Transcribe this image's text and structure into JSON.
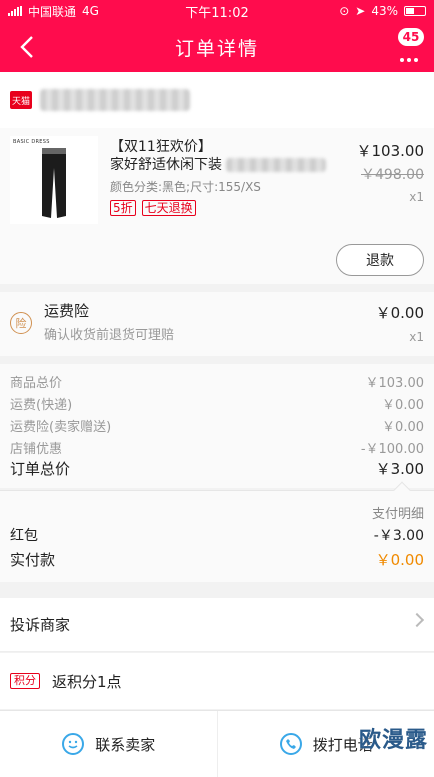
{
  "status": {
    "carrier": "中国联通",
    "network": "4G",
    "time": "下午11:02",
    "battery": "43%"
  },
  "nav": {
    "title": "订单详情",
    "badge": "45"
  },
  "shop": {
    "logo_text": "天猫"
  },
  "product": {
    "brand_text": "BASIC DRESS",
    "title_line1": "【双11狂欢价】",
    "title_line2": "家好舒适休闲下装",
    "sku": "颜色分类:黑色;尺寸:155/XS",
    "tags": [
      "5折",
      "七天退换"
    ],
    "price": "￥103.00",
    "original_price": "￥498.00",
    "qty": "x1",
    "refund_label": "退款"
  },
  "insurance": {
    "icon": "险",
    "name": "运费险",
    "sub": "确认收货前退货可理赔",
    "price": "￥0.00",
    "qty": "x1"
  },
  "summary": {
    "rows": [
      {
        "label": "商品总价",
        "value": "￥103.00"
      },
      {
        "label": "运费(快递)",
        "value": "￥0.00"
      },
      {
        "label": "运费险(卖家赠送)",
        "value": "￥0.00"
      },
      {
        "label": "店铺优惠",
        "value": "-￥100.00"
      }
    ],
    "total_label": "订单总价",
    "total_value": "￥3.00"
  },
  "payment": {
    "detail_label": "支付明细",
    "redpack_label": "红包",
    "redpack_value": "-￥3.00",
    "paid_label": "实付款",
    "paid_value": "￥0.00"
  },
  "complain_label": "投诉商家",
  "points": {
    "badge": "积分",
    "text": "返积分1点"
  },
  "footer": {
    "contact_label": "联系卖家",
    "call_label": "拨打电话"
  },
  "watermark": "欧漫露",
  "colors": {
    "brand": "#ff0c4d",
    "tag": "#e8001c",
    "paid": "#f08a00"
  }
}
